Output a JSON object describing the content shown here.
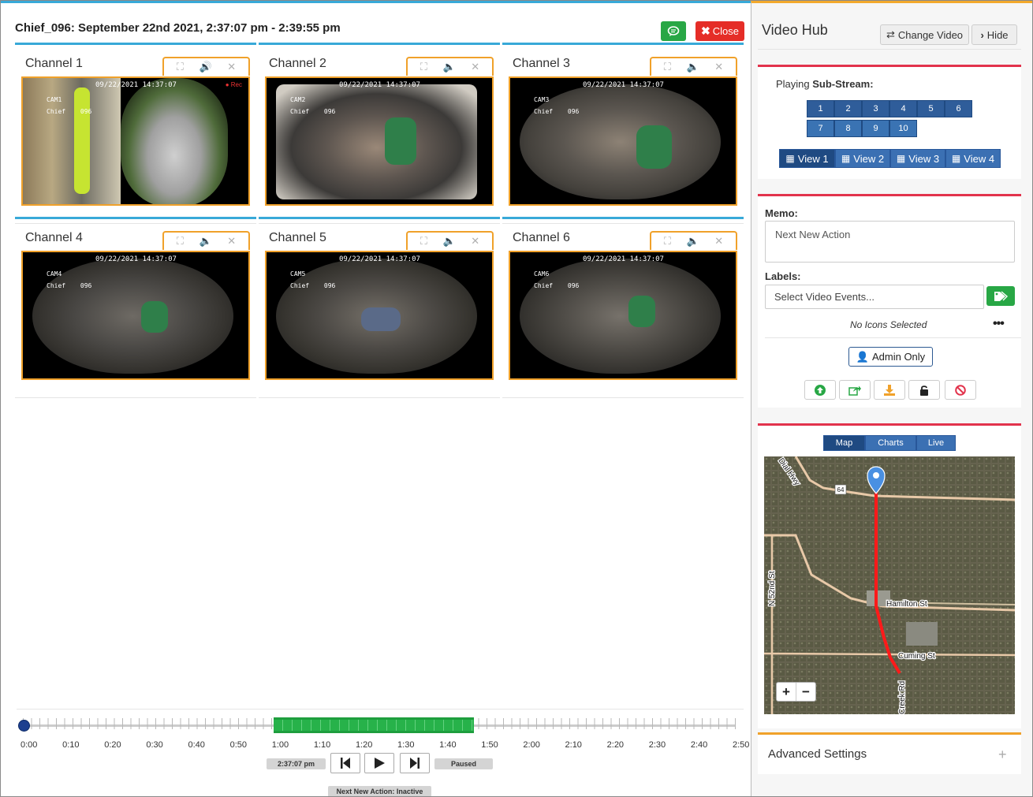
{
  "header": {
    "title": "Chief_096: September 22nd 2021, 2:37:07 pm - 2:39:55 pm",
    "close_label": "Close"
  },
  "channels": [
    {
      "label": "Channel 1",
      "timestamp": "09/22/2021  14:37:07",
      "cam": "CAM1",
      "bus": "Chief",
      "unit": "096",
      "rec": "Rec"
    },
    {
      "label": "Channel 2",
      "timestamp": "09/22/2021  14:37:07",
      "cam": "CAM2",
      "bus": "Chief",
      "unit": "096"
    },
    {
      "label": "Channel 3",
      "timestamp": "09/22/2021  14:37:07",
      "cam": "CAM3",
      "bus": "Chief",
      "unit": "096"
    },
    {
      "label": "Channel 4",
      "timestamp": "09/22/2021  14:37:07",
      "cam": "CAM4",
      "bus": "Chief",
      "unit": "096"
    },
    {
      "label": "Channel 5",
      "timestamp": "09/22/2021  14:37:07",
      "cam": "CAM5",
      "bus": "Chief",
      "unit": "096"
    },
    {
      "label": "Channel 6",
      "timestamp": "09/22/2021  14:37:07",
      "cam": "CAM6",
      "bus": "Chief",
      "unit": "096"
    }
  ],
  "timeline": {
    "labels": [
      "0:00",
      "0:10",
      "0:20",
      "0:30",
      "0:40",
      "0:50",
      "1:00",
      "1:10",
      "1:20",
      "1:30",
      "1:40",
      "1:50",
      "2:00",
      "2:10",
      "2:20",
      "2:30",
      "2:40",
      "2:50"
    ],
    "current_time": "2:37:07 pm",
    "state": "Paused",
    "next_action": "Next New Action: Inactive",
    "progress": 0.0
  },
  "hub": {
    "title": "Video Hub",
    "change_video": "Change Video",
    "hide": "Hide",
    "playing_prefix": "Playing ",
    "playing_bold": "Sub-Stream:",
    "streams_row1": [
      "1",
      "2",
      "3",
      "4",
      "5",
      "6"
    ],
    "streams_row2": [
      "7",
      "8",
      "9",
      "10"
    ],
    "views": [
      "View 1",
      "View 2",
      "View 3",
      "View 4"
    ],
    "memo_label": "Memo:",
    "memo_value": "Next New Action",
    "labels_label": "Labels:",
    "labels_placeholder": "Select Video Events...",
    "no_icons": "No Icons Selected",
    "admin_only": "Admin Only",
    "map_tabs": [
      "Map",
      "Charts",
      "Live"
    ],
    "map_streets": [
      "Hamilton St",
      "Cuming St",
      "N 52nd St",
      "Creek Rd",
      "Dial Hwy",
      "64"
    ],
    "advanced": "Advanced Settings"
  },
  "colors": {
    "accent_blue": "#38a9d8",
    "orange": "#f0a12a",
    "red": "#e2334c",
    "green": "#28a745",
    "navy": "#1f4a82"
  }
}
